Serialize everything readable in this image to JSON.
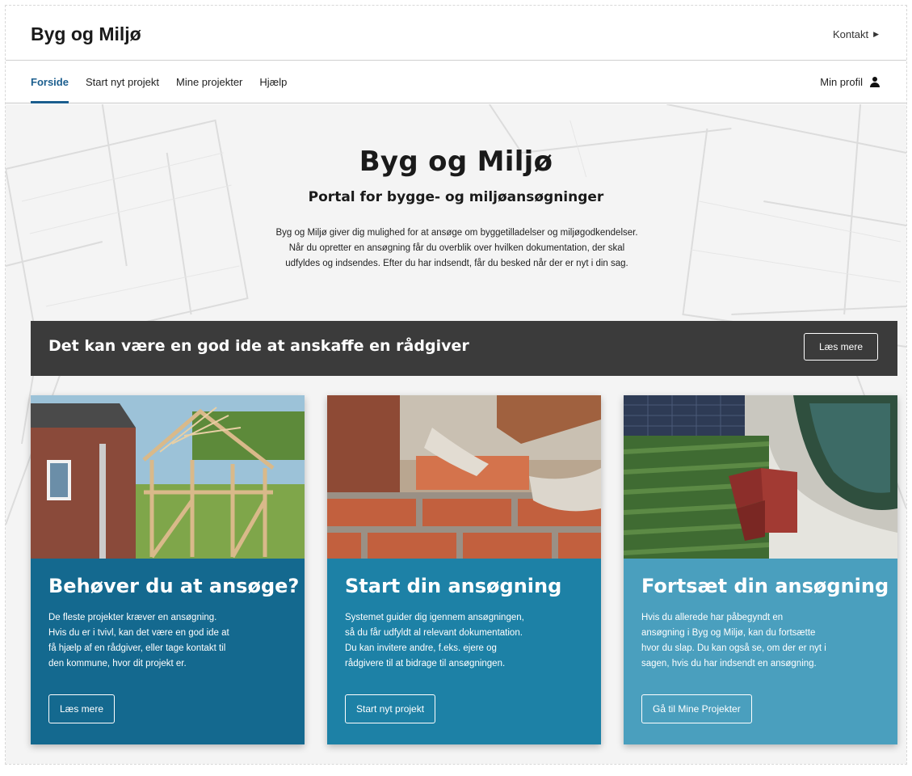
{
  "header": {
    "brand": "Byg og Miljø",
    "contact_label": "Kontakt"
  },
  "nav": {
    "tabs": [
      {
        "label": "Forside",
        "active": true
      },
      {
        "label": "Start nyt projekt",
        "active": false
      },
      {
        "label": "Mine projekter",
        "active": false
      },
      {
        "label": "Hjælp",
        "active": false
      }
    ],
    "profile_label": "Min profil"
  },
  "hero": {
    "title": "Byg og Miljø",
    "subtitle": "Portal for bygge- og miljøansøgninger",
    "text_lines": [
      "Byg og Miljø giver dig mulighed for at ansøge om byggetilladelser og miljøgodkendelser.",
      "Når du opretter en ansøgning får du overblik over hvilken dokumentation, der skal",
      "udfyldes og indsendes. Efter du har indsendt, får du besked når der er nyt i din sag."
    ]
  },
  "banner": {
    "title": "Det kan være en god ide at anskaffe en rådgiver",
    "button_label": "Læs mere"
  },
  "cards": [
    {
      "title": "Behøver du at ansøge?",
      "text_lines": [
        "De fleste projekter kræver en ansøgning.",
        "Hvis du er i tvivl, kan det være en god ide at",
        "få hjælp af en rådgiver, eller tage kontakt til",
        "den kommune, hvor dit projekt er."
      ],
      "button_label": "Læs mere",
      "image_icon": "house-frame-photo"
    },
    {
      "title": "Start din ansøgning",
      "text_lines": [
        "Systemet guider dig igennem ansøgningen,",
        "så du får udfyldt al relevant dokumentation.",
        "Du kan invitere andre, f.eks. ejere og",
        "rådgivere til at bidrage til ansøgningen."
      ],
      "button_label": "Start nyt projekt",
      "image_icon": "bricklaying-photo"
    },
    {
      "title": "Fortsæt din ansøgning",
      "text_lines": [
        "Hvis du allerede har påbegyndt en",
        "ansøgning i Byg og Miljø, kan du fortsætte",
        "hvor du slap. Du kan også se, om der er nyt i",
        "sagen, hvis du har indsendt en ansøgning."
      ],
      "button_label": "Gå til Mine Projekter",
      "image_icon": "aerial-house-photo"
    }
  ],
  "colors": {
    "accent": "#1b5e8e",
    "banner_bg": "#3b3b3b",
    "card1_bg": "#14698f",
    "card2_bg": "#1d81a6",
    "card3_bg": "#4a9fbe"
  }
}
